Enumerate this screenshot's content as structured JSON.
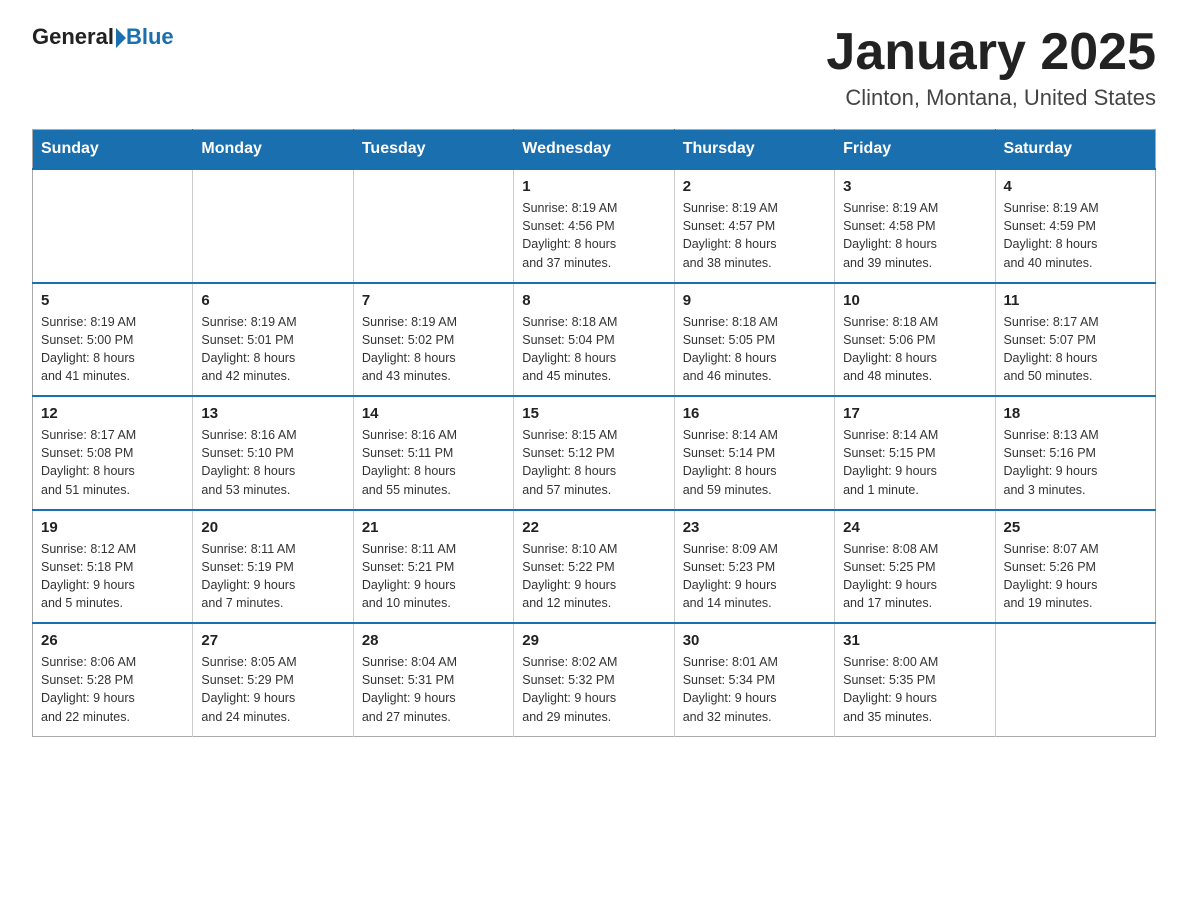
{
  "logo": {
    "general": "General",
    "blue": "Blue"
  },
  "title": "January 2025",
  "subtitle": "Clinton, Montana, United States",
  "weekdays": [
    "Sunday",
    "Monday",
    "Tuesday",
    "Wednesday",
    "Thursday",
    "Friday",
    "Saturday"
  ],
  "weeks": [
    [
      {
        "day": "",
        "info": ""
      },
      {
        "day": "",
        "info": ""
      },
      {
        "day": "",
        "info": ""
      },
      {
        "day": "1",
        "info": "Sunrise: 8:19 AM\nSunset: 4:56 PM\nDaylight: 8 hours\nand 37 minutes."
      },
      {
        "day": "2",
        "info": "Sunrise: 8:19 AM\nSunset: 4:57 PM\nDaylight: 8 hours\nand 38 minutes."
      },
      {
        "day": "3",
        "info": "Sunrise: 8:19 AM\nSunset: 4:58 PM\nDaylight: 8 hours\nand 39 minutes."
      },
      {
        "day": "4",
        "info": "Sunrise: 8:19 AM\nSunset: 4:59 PM\nDaylight: 8 hours\nand 40 minutes."
      }
    ],
    [
      {
        "day": "5",
        "info": "Sunrise: 8:19 AM\nSunset: 5:00 PM\nDaylight: 8 hours\nand 41 minutes."
      },
      {
        "day": "6",
        "info": "Sunrise: 8:19 AM\nSunset: 5:01 PM\nDaylight: 8 hours\nand 42 minutes."
      },
      {
        "day": "7",
        "info": "Sunrise: 8:19 AM\nSunset: 5:02 PM\nDaylight: 8 hours\nand 43 minutes."
      },
      {
        "day": "8",
        "info": "Sunrise: 8:18 AM\nSunset: 5:04 PM\nDaylight: 8 hours\nand 45 minutes."
      },
      {
        "day": "9",
        "info": "Sunrise: 8:18 AM\nSunset: 5:05 PM\nDaylight: 8 hours\nand 46 minutes."
      },
      {
        "day": "10",
        "info": "Sunrise: 8:18 AM\nSunset: 5:06 PM\nDaylight: 8 hours\nand 48 minutes."
      },
      {
        "day": "11",
        "info": "Sunrise: 8:17 AM\nSunset: 5:07 PM\nDaylight: 8 hours\nand 50 minutes."
      }
    ],
    [
      {
        "day": "12",
        "info": "Sunrise: 8:17 AM\nSunset: 5:08 PM\nDaylight: 8 hours\nand 51 minutes."
      },
      {
        "day": "13",
        "info": "Sunrise: 8:16 AM\nSunset: 5:10 PM\nDaylight: 8 hours\nand 53 minutes."
      },
      {
        "day": "14",
        "info": "Sunrise: 8:16 AM\nSunset: 5:11 PM\nDaylight: 8 hours\nand 55 minutes."
      },
      {
        "day": "15",
        "info": "Sunrise: 8:15 AM\nSunset: 5:12 PM\nDaylight: 8 hours\nand 57 minutes."
      },
      {
        "day": "16",
        "info": "Sunrise: 8:14 AM\nSunset: 5:14 PM\nDaylight: 8 hours\nand 59 minutes."
      },
      {
        "day": "17",
        "info": "Sunrise: 8:14 AM\nSunset: 5:15 PM\nDaylight: 9 hours\nand 1 minute."
      },
      {
        "day": "18",
        "info": "Sunrise: 8:13 AM\nSunset: 5:16 PM\nDaylight: 9 hours\nand 3 minutes."
      }
    ],
    [
      {
        "day": "19",
        "info": "Sunrise: 8:12 AM\nSunset: 5:18 PM\nDaylight: 9 hours\nand 5 minutes."
      },
      {
        "day": "20",
        "info": "Sunrise: 8:11 AM\nSunset: 5:19 PM\nDaylight: 9 hours\nand 7 minutes."
      },
      {
        "day": "21",
        "info": "Sunrise: 8:11 AM\nSunset: 5:21 PM\nDaylight: 9 hours\nand 10 minutes."
      },
      {
        "day": "22",
        "info": "Sunrise: 8:10 AM\nSunset: 5:22 PM\nDaylight: 9 hours\nand 12 minutes."
      },
      {
        "day": "23",
        "info": "Sunrise: 8:09 AM\nSunset: 5:23 PM\nDaylight: 9 hours\nand 14 minutes."
      },
      {
        "day": "24",
        "info": "Sunrise: 8:08 AM\nSunset: 5:25 PM\nDaylight: 9 hours\nand 17 minutes."
      },
      {
        "day": "25",
        "info": "Sunrise: 8:07 AM\nSunset: 5:26 PM\nDaylight: 9 hours\nand 19 minutes."
      }
    ],
    [
      {
        "day": "26",
        "info": "Sunrise: 8:06 AM\nSunset: 5:28 PM\nDaylight: 9 hours\nand 22 minutes."
      },
      {
        "day": "27",
        "info": "Sunrise: 8:05 AM\nSunset: 5:29 PM\nDaylight: 9 hours\nand 24 minutes."
      },
      {
        "day": "28",
        "info": "Sunrise: 8:04 AM\nSunset: 5:31 PM\nDaylight: 9 hours\nand 27 minutes."
      },
      {
        "day": "29",
        "info": "Sunrise: 8:02 AM\nSunset: 5:32 PM\nDaylight: 9 hours\nand 29 minutes."
      },
      {
        "day": "30",
        "info": "Sunrise: 8:01 AM\nSunset: 5:34 PM\nDaylight: 9 hours\nand 32 minutes."
      },
      {
        "day": "31",
        "info": "Sunrise: 8:00 AM\nSunset: 5:35 PM\nDaylight: 9 hours\nand 35 minutes."
      },
      {
        "day": "",
        "info": ""
      }
    ]
  ]
}
